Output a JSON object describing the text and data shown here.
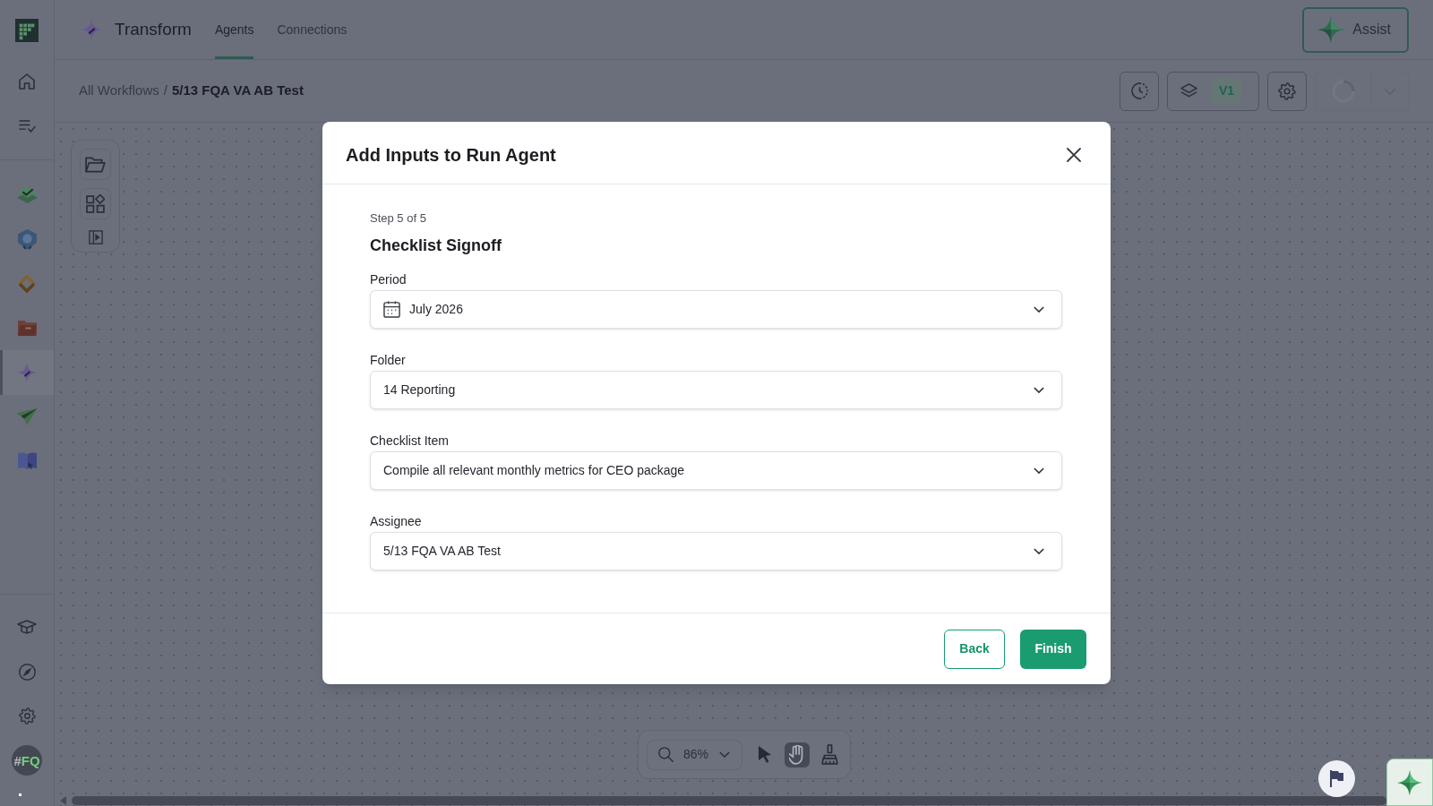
{
  "sidebar": {
    "nav_items": [
      {
        "selected": false
      },
      {
        "selected": false
      },
      {
        "selected": false
      },
      {
        "selected": false
      },
      {
        "selected": true
      },
      {
        "selected": false
      },
      {
        "selected": false
      }
    ],
    "workspace_badge": "#FQ"
  },
  "header": {
    "app_title": "Transform",
    "tabs": [
      {
        "label": "Agents",
        "selected": true
      },
      {
        "label": "Connections",
        "selected": false
      }
    ],
    "assist_button": "Assist"
  },
  "breadcrumb": {
    "items": [
      "All Workflows",
      "5/13 FQA VA AB Test"
    ],
    "separator": "/"
  },
  "toolbar": {
    "version_badge": "V1",
    "run_control": {
      "disabled": true
    }
  },
  "canvas": {
    "zoom_level": "86%",
    "tools": [
      {
        "selected": false
      },
      {
        "selected": true
      },
      {
        "selected": false
      }
    ]
  },
  "modal": {
    "title": "Add Inputs to Run Agent",
    "step": "Step 5 of 5",
    "section_title": "Checklist Signoff",
    "fields": [
      {
        "label": "Period",
        "kind": "date",
        "value": "July 2026"
      },
      {
        "label": "Folder",
        "kind": "select",
        "value": "14 Reporting"
      },
      {
        "label": "Checklist Item",
        "kind": "select",
        "value": "Compile all relevant monthly metrics for CEO package"
      },
      {
        "label": "Assignee",
        "kind": "select",
        "value": "5/13 FQA VA AB Test"
      }
    ],
    "buttons": [
      {
        "label": "Back",
        "kind": "secondary"
      },
      {
        "label": "Finish",
        "kind": "primary"
      }
    ]
  }
}
